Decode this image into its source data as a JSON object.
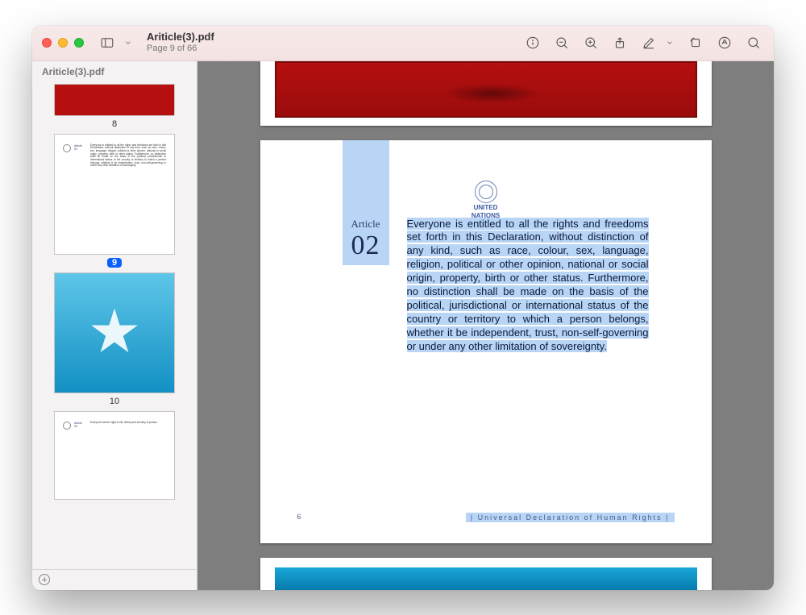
{
  "window": {
    "title": "Ariticle(3).pdf",
    "subtitle": "Page 9 of 66"
  },
  "sidebar": {
    "doc_name": "Ariticle(3).pdf",
    "thumbs": [
      {
        "page": "8",
        "kind": "red-art",
        "current": false
      },
      {
        "page": "9",
        "kind": "text-02",
        "current": true
      },
      {
        "page": "10",
        "kind": "blue-art",
        "current": false
      },
      {
        "page": "",
        "kind": "text-03",
        "current": false
      }
    ]
  },
  "thumb_text02": {
    "label": "Article",
    "num": "02",
    "body": "Everyone is entitled to all the rights and freedoms set forth in this Declaration, without distinction of any kind, such as race, colour, sex, language, religion, political or other opinion, national or social origin, property, birth or other status. Furthermore, no distinction shall be made on the basis of the political, jurisdictional or international status of the country or territory to which a person belongs, whether it be independent, trust, non-self-governing or under any other limitation of sovereignty."
  },
  "thumb_text03": {
    "label": "Article",
    "num": "03",
    "body": "Everyone has the right to life, liberty and security of person."
  },
  "main_page": {
    "un1": "UNITED",
    "un2": "NATIONS",
    "article_label": "Article",
    "article_num": "02",
    "body": "Everyone is entitled to all the rights and freedoms set forth in this Declaration, without distinction of any kind, such as race, colour, sex, language, religion, political or other opinion, national or social origin, property, birth or other status. Furthermore, no distinction shall be made on the basis of the political, jurisdictional or international status of the country or territory to which a person belongs, whether it be independent, trust, non-self-governing or under any other limitation of sovereignty.",
    "footer_page": "6",
    "footer_text": "| Universal Declaration of Human Rights |"
  }
}
